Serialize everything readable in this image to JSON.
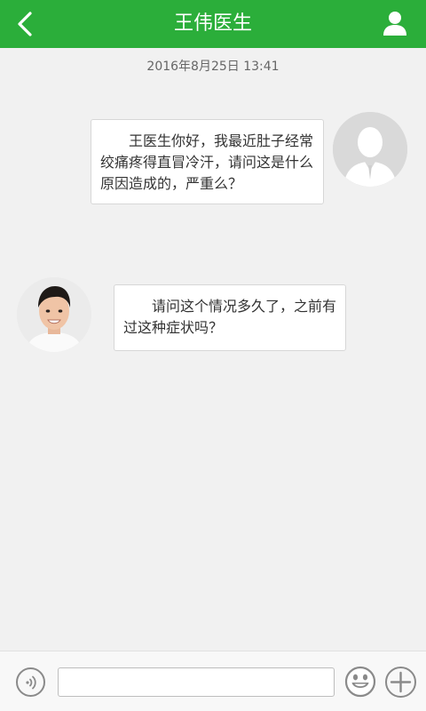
{
  "header": {
    "title": "王伟医生",
    "back_icon": "chevron-left-icon",
    "profile_icon": "user-icon",
    "background": "#2bae3a"
  },
  "chat": {
    "timestamp": "2016年8月25日 13:41",
    "messages": [
      {
        "sender": "me",
        "text": "王医生你好，我最近肚子经常绞痛疼得直冒冷汗，请问这是什么原因造成的，严重么？"
      },
      {
        "sender": "doctor",
        "text": "请问这个情况多久了，之前有过这种症状吗？"
      }
    ]
  },
  "input_bar": {
    "voice_icon": "voice-icon",
    "message_value": "",
    "emoji_icon": "emoji-icon",
    "plus_icon": "plus-icon"
  }
}
